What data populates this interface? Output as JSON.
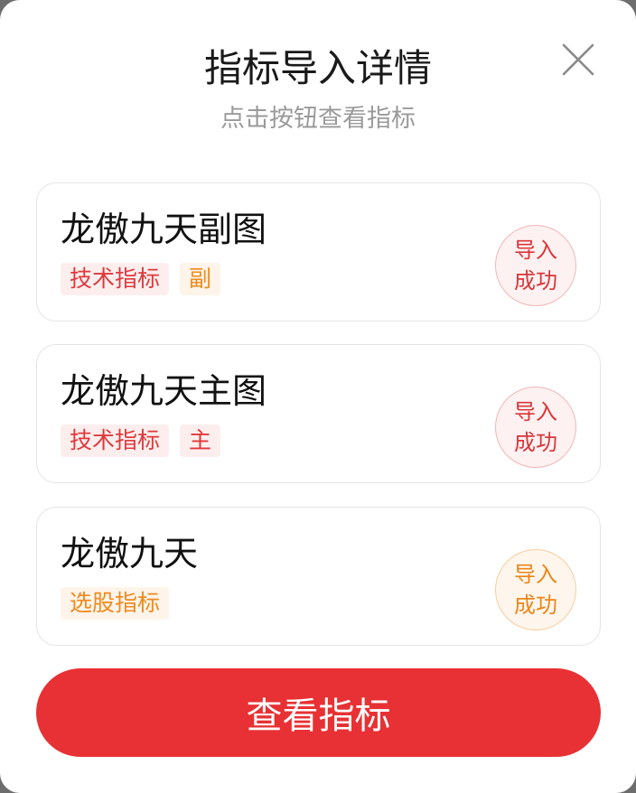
{
  "modal": {
    "title": "指标导入详情",
    "subtitle": "点击按钮查看指标",
    "close_icon": "close-icon"
  },
  "indicators": [
    {
      "name": "龙傲九天副图",
      "tags": [
        {
          "text": "技术指标",
          "color": "#e0393c"
        },
        {
          "text": "副",
          "color": "#ef8a1e"
        }
      ],
      "status_line1": "导入",
      "status_line2": "成功",
      "status_color": "#d7373a"
    },
    {
      "name": "龙傲九天主图",
      "tags": [
        {
          "text": "技术指标",
          "color": "#e0393c"
        },
        {
          "text": "主",
          "color": "#e0393c"
        }
      ],
      "status_line1": "导入",
      "status_line2": "成功",
      "status_color": "#d7373a"
    },
    {
      "name": "龙傲九天",
      "tags": [
        {
          "text": "选股指标",
          "color": "#ef8a1e"
        }
      ],
      "status_line1": "导入",
      "status_line2": "成功",
      "status_color": "#ea861c"
    }
  ],
  "actions": {
    "view_button_label": "查看指标",
    "button_color": "#e83134"
  }
}
